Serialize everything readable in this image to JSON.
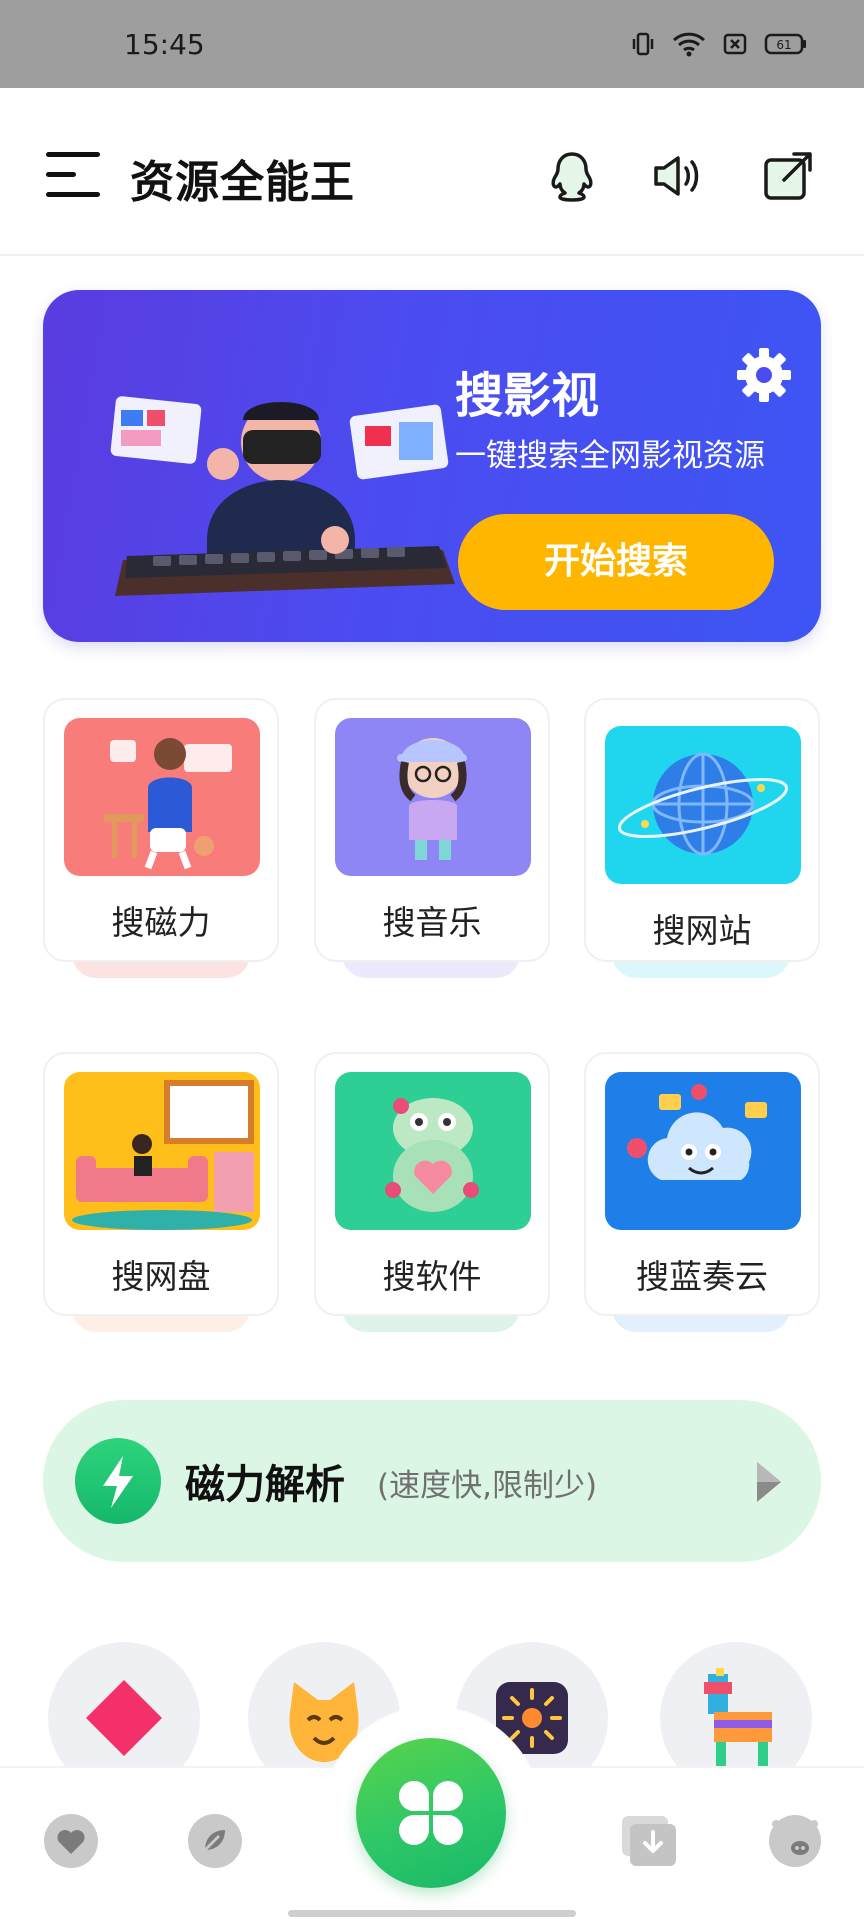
{
  "status_bar": {
    "time": "15:45",
    "battery": "61"
  },
  "header": {
    "title": "资源全能王"
  },
  "banner": {
    "title": "搜影视",
    "subtitle": "一键搜索全网影视资源",
    "button_label": "开始搜索"
  },
  "tiles": [
    {
      "label": "搜磁力",
      "color": "#f87c7a"
    },
    {
      "label": "搜音乐",
      "color": "#8e86f5"
    },
    {
      "label": "搜网站",
      "color": "#20d6ef"
    },
    {
      "label": "搜网盘",
      "color": "#ffbe1a"
    },
    {
      "label": "搜软件",
      "color": "#2ecf95"
    },
    {
      "label": "搜蓝奏云",
      "color": "#1f7fe8"
    }
  ],
  "magnet": {
    "title": "磁力解析",
    "note": "(速度快,限制少)"
  },
  "bottom_nav": {
    "items": [
      "heart-icon",
      "leaf-icon",
      "clover-icon",
      "download-box-icon",
      "pig-icon"
    ]
  }
}
